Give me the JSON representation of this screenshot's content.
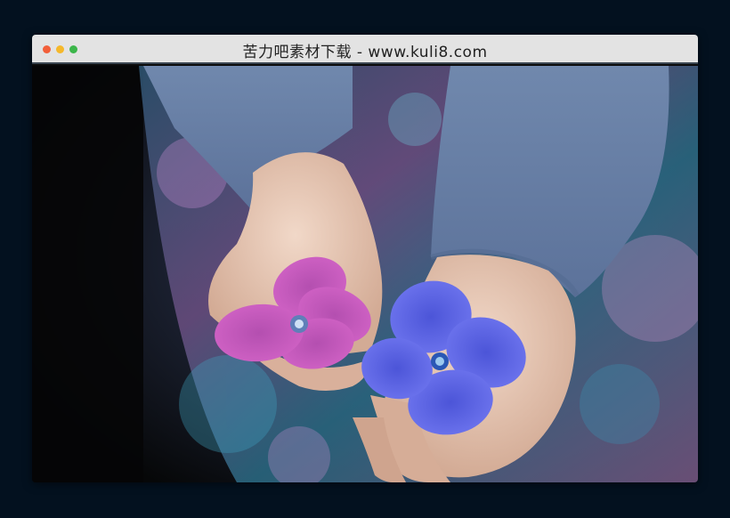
{
  "window": {
    "title": "苦力吧素材下载 - www.kuli8.com",
    "controls": [
      {
        "name": "close",
        "color": "#f25f3a"
      },
      {
        "name": "minimize",
        "color": "#f5b82b"
      },
      {
        "name": "maximize",
        "color": "#3cb64a"
      }
    ]
  },
  "colors": {
    "page_background": "#03111f",
    "titlebar": "#e3e3e3",
    "sweater": "#6f88ad",
    "pink_flower": "#c253b8",
    "blue_flower": "#5a63e0"
  },
  "photo": {
    "subject": "hands holding pink and blue hydrangea flowers"
  }
}
